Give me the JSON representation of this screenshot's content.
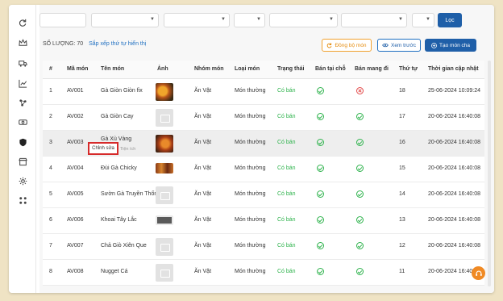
{
  "sidebar": {
    "icons": [
      "refresh-icon",
      "crown-icon",
      "truck-icon",
      "chart-icon",
      "network-icon",
      "money-icon",
      "shield-icon",
      "store-icon",
      "settings-icon",
      "apps-icon"
    ]
  },
  "filters": {
    "apply_label": "Lọc"
  },
  "summary": {
    "count_label": "SỐ LƯỢNG: 70",
    "sort_link": "Sắp xếp thứ tự hiển thị"
  },
  "actions": {
    "sync_label": "Đồng bộ món",
    "preview_label": "Xem trước",
    "add_label": "Tạo món cha"
  },
  "table": {
    "headers": [
      "#",
      "Mã món",
      "Tên món",
      "Ảnh",
      "Nhóm món",
      "Loại món",
      "Trạng thái",
      "Bán tại chỗ",
      "Bán mang đi",
      "Thứ tự",
      "Thời gian cập nhật"
    ],
    "rows": [
      {
        "idx": "1",
        "code": "AV001",
        "name": "Gà Giòn Giòn fix",
        "image": "food1",
        "group": "Ăn Vặt",
        "type": "Món thường",
        "status": "Có bán",
        "dine_in": true,
        "takeaway": false,
        "order": "18",
        "updated": "25-06-2024 10:09:24"
      },
      {
        "idx": "2",
        "code": "AV002",
        "name": "Gà Giòn Cay",
        "image": "placeholder",
        "group": "Ăn Vặt",
        "type": "Món thường",
        "status": "Có bán",
        "dine_in": true,
        "takeaway": true,
        "order": "17",
        "updated": "20-06-2024 16:40:08"
      },
      {
        "idx": "3",
        "code": "AV003",
        "name": "Gà Xù Vàng",
        "image": "food2",
        "group": "Ăn Vặt",
        "type": "Món thường",
        "status": "Có bán",
        "dine_in": true,
        "takeaway": true,
        "order": "16",
        "updated": "20-06-2024 16:40:08"
      },
      {
        "idx": "4",
        "code": "AV004",
        "name": "Đùi Gà Chicky",
        "image": "food3",
        "group": "Ăn Vặt",
        "type": "Món thường",
        "status": "Có bán",
        "dine_in": true,
        "takeaway": true,
        "order": "15",
        "updated": "20-06-2024 16:40:08"
      },
      {
        "idx": "5",
        "code": "AV005",
        "name": "Sườn Gà Truyền Thống",
        "image": "placeholder",
        "group": "Ăn Vặt",
        "type": "Món thường",
        "status": "Có bán",
        "dine_in": true,
        "takeaway": true,
        "order": "14",
        "updated": "20-06-2024 16:40:08"
      },
      {
        "idx": "6",
        "code": "AV006",
        "name": "Khoai Tây Lắc",
        "image": "food4",
        "group": "Ăn Vặt",
        "type": "Món thường",
        "status": "Có bán",
        "dine_in": true,
        "takeaway": true,
        "order": "13",
        "updated": "20-06-2024 16:40:08"
      },
      {
        "idx": "7",
        "code": "AV007",
        "name": "Chả Giò Xiên Que",
        "image": "placeholder",
        "group": "Ăn Vặt",
        "type": "Món thường",
        "status": "Có bán",
        "dine_in": true,
        "takeaway": true,
        "order": "12",
        "updated": "20-06-2024 16:40:08"
      },
      {
        "idx": "8",
        "code": "AV008",
        "name": "Nugget Cá",
        "image": "placeholder",
        "group": "Ăn Vặt",
        "type": "Món thường",
        "status": "Có bán",
        "dine_in": true,
        "takeaway": true,
        "order": "11",
        "updated": "20-06-2024 16:40:08"
      }
    ]
  },
  "row_menu": {
    "edit_label": "Chỉnh sửa",
    "extra_label": "Tiện ích"
  },
  "colors": {
    "primary": "#1f5fa8",
    "accent_orange": "#f08a24",
    "status_green": "#2fb34d",
    "status_red": "#e34b4b",
    "highlight_red": "#d62a2a"
  }
}
